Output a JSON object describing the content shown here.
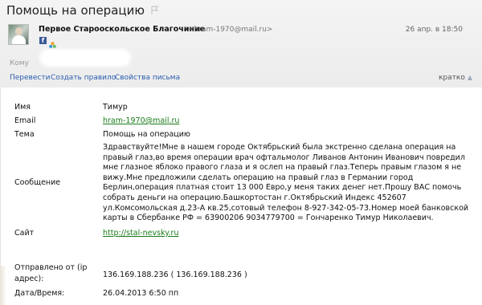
{
  "header": {
    "subject": "Помощь на операцию",
    "sender_name": "Первое Старооскольское Благочиние",
    "sender_email": "<hram-1970@mail.ru>",
    "date": "26 апр. в 18:50",
    "to_label": "Кому",
    "icons": [
      "flag-icon",
      "avatar",
      "facebook-icon",
      "mail-agent-icon"
    ]
  },
  "actions": {
    "translate": "Перевести",
    "create_rule": "Создать правило",
    "properties": "Свойства письма",
    "short": "кратко"
  },
  "form": {
    "name_label": "Имя",
    "name_value": "Тимур",
    "email_label": "Email",
    "email_value": "hram-1970@mail.ru",
    "topic_label": "Тема",
    "topic_value": "Помощь на операцию",
    "message_label": "Сообщение",
    "message_value": "Здравствуйте!Мне в нашем городе Октябрьский была экстренно сделана операция на правый глаз,во время операции врач офтальмолог Ливанов Антонин Иванович повредил мне глазное яблоко правого глаза и я ослеп на правый глаз.Теперь правым глазом я не вижу.Мне предложили сделать операцию на правый глаз в Германии город Берлин,операция платная стоит 13 000 Евро,у меня таких денег нет.Прошу ВАС помочь собрать деньги на операцию.Башкортостан г.Октябрьский Индекс 452607 ул.Комсомольская д.23-А кв.25,сотовый телефон 8-927-342-05-73.Номер моей банковской карты в Сбербанке РФ = 63900206 9034779700 = Гончаренко Тимур Николаевич.",
    "site_label": "Сайт",
    "site_value": "http://stal-nevsky.ru",
    "ip_label_1": "Отправлено от (ip",
    "ip_label_2": "адрес):",
    "ip_value": "136.169.188.236 ( 136.169.188.236 )",
    "datetime_label": "Дата/Время:",
    "datetime_value": "26.04.2013 6:50 пп"
  },
  "colors": {
    "link": "#2a5db0",
    "green_link": "#1a7a1a",
    "facebook": "#3b5998"
  }
}
